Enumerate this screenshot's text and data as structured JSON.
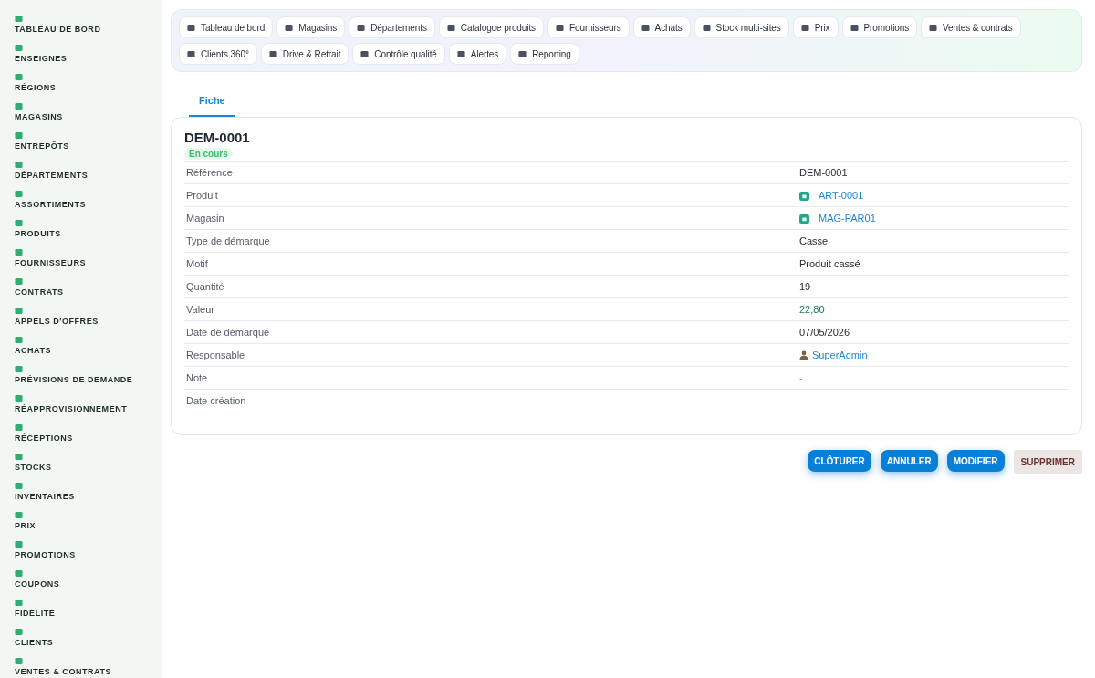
{
  "sidebar": {
    "items": [
      "TABLEAU DE BORD",
      "ENSEIGNES",
      "RÉGIONS",
      "MAGASINS",
      "ENTREPÔTS",
      "DÉPARTEMENTS",
      "ASSORTIMENTS",
      "PRODUITS",
      "FOURNISSEURS",
      "CONTRATS",
      "APPELS D'OFFRES",
      "ACHATS",
      "PRÉVISIONS DE DEMANDE",
      "RÉAPPROVISIONNEMENT",
      "RÉCEPTIONS",
      "STOCKS",
      "INVENTAIRES",
      "PRIX",
      "PROMOTIONS",
      "COUPONS",
      "FIDELITE",
      "CLIENTS",
      "VENTES & CONTRATS"
    ]
  },
  "nav": [
    "Tableau de bord",
    "Magasins",
    "Départements",
    "Catalogue produits",
    "Fournisseurs",
    "Achats",
    "Stock multi-sites",
    "Prix",
    "Promotions",
    "Ventes & contrats",
    "Clients 360°",
    "Drive & Retrait",
    "Contrôle qualité",
    "Alertes",
    "Reporting"
  ],
  "tabs": [
    {
      "label": "Fiche",
      "selected": true
    }
  ],
  "record": {
    "title": "DEM-0001",
    "status": "En cours",
    "fields": [
      {
        "label": "Référence",
        "kind": "text",
        "value": "DEM-0001"
      },
      {
        "label": "Produit",
        "kind": "link",
        "value": "ART-0001"
      },
      {
        "label": "Magasin",
        "kind": "link",
        "value": "MAG-PAR01"
      },
      {
        "label": "Type de démarque",
        "kind": "text",
        "value": "Casse"
      },
      {
        "label": "Motif",
        "kind": "text",
        "value": "Produit cassé"
      },
      {
        "label": "Quantité",
        "kind": "text",
        "value": "19"
      },
      {
        "label": "Valeur",
        "kind": "money",
        "value": "22,80"
      },
      {
        "label": "Date de démarque",
        "kind": "text",
        "value": "07/05/2026"
      },
      {
        "label": "Responsable",
        "kind": "user",
        "value": "SuperAdmin"
      },
      {
        "label": "Note",
        "kind": "muted",
        "value": "-"
      },
      {
        "label": "Date création",
        "kind": "empty"
      }
    ]
  },
  "actions": [
    {
      "label": "CLÔTURER",
      "kind": "primary"
    },
    {
      "label": "ANNULER",
      "kind": "primary"
    },
    {
      "label": "MODIFIER",
      "kind": "primary"
    },
    {
      "label": "SUPPRIMER",
      "kind": "danger"
    }
  ]
}
